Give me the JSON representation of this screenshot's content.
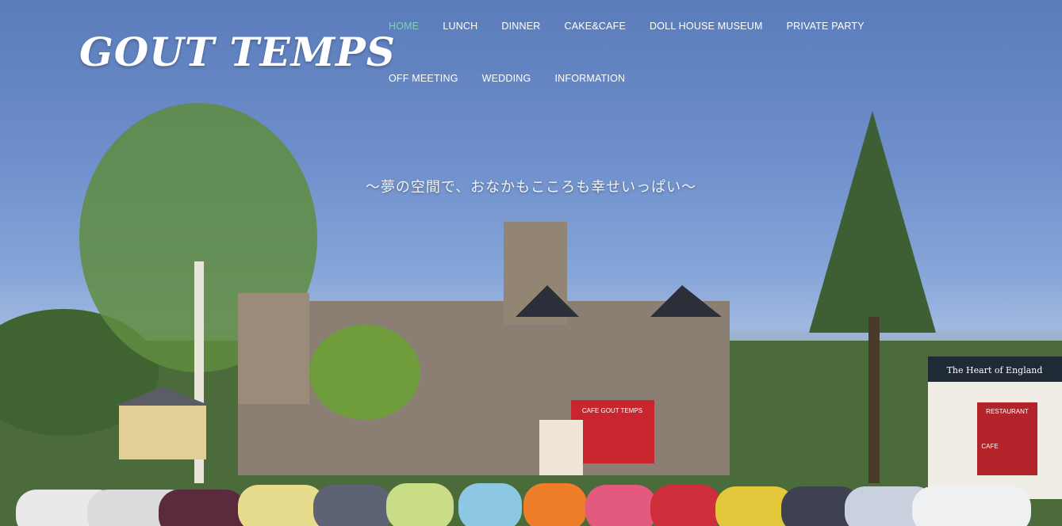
{
  "brand": {
    "logo_text": "GOUT TEMPS"
  },
  "nav": {
    "items": [
      {
        "label": "HOME",
        "active": true
      },
      {
        "label": "LUNCH",
        "active": false
      },
      {
        "label": "DINNER",
        "active": false
      },
      {
        "label": "CAKE&CAFE",
        "active": false
      },
      {
        "label": "DOLL HOUSE MUSEUM",
        "active": false
      },
      {
        "label": "PRIVATE PARTY",
        "active": false
      },
      {
        "label": "OFF MEETING",
        "active": false
      },
      {
        "label": "WEDDING",
        "active": false
      },
      {
        "label": "INFORMATION",
        "active": false
      }
    ]
  },
  "hero": {
    "tagline": "〜夢の空間で、おなかもこころも幸せいっぱい〜",
    "building_sign": "CAFE GOUT TEMPS",
    "side_sign": "The Heart of England",
    "restaurant_sign": "RESTAURANT",
    "cafe_sign": "CAFE"
  },
  "colors": {
    "nav_active": "#7ed0b6",
    "nav_text": "#ffffff",
    "sky": "#6e8fcb"
  }
}
